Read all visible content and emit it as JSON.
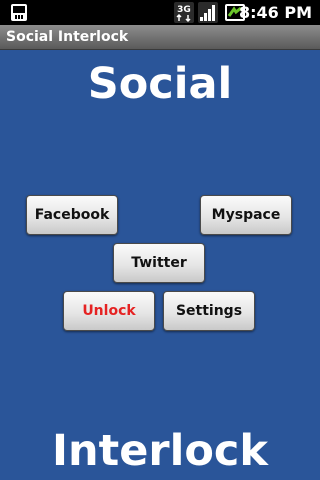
{
  "status_bar": {
    "time": "8:46 PM",
    "network_label": "3G",
    "icons": [
      "sd-card-icon",
      "3g-data-icon",
      "signal-strength-icon",
      "battery-charging-icon"
    ]
  },
  "app": {
    "title": "Social Interlock"
  },
  "main": {
    "heading_top": "Social",
    "heading_bottom": "Interlock",
    "buttons": {
      "facebook": "Facebook",
      "myspace": "Myspace",
      "twitter": "Twitter",
      "unlock": "Unlock",
      "settings": "Settings"
    }
  },
  "colors": {
    "background": "#2a5599",
    "unlock_text": "#e52222",
    "title_bar": "#7a7a7a"
  }
}
